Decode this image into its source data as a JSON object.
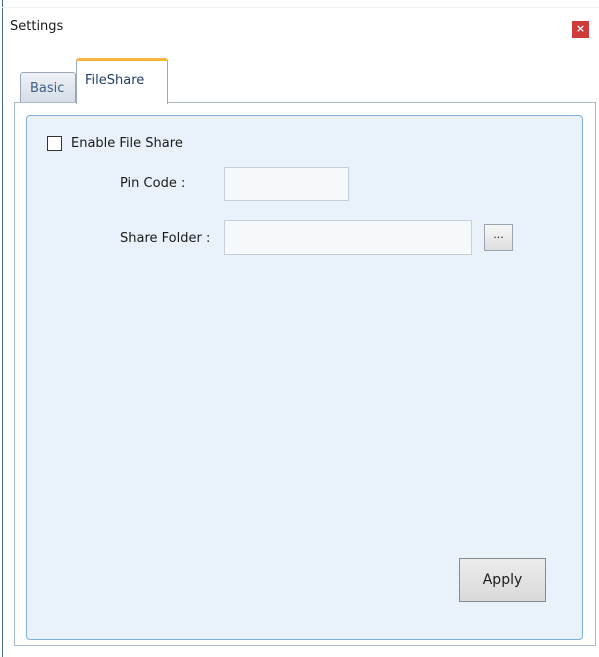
{
  "window": {
    "title": "Settings",
    "close_glyph": "×"
  },
  "tabs": [
    {
      "label": "Basic",
      "active": false
    },
    {
      "label": "FileShare",
      "active": true
    }
  ],
  "fileshare": {
    "enable_label": "Enable File Share",
    "enable_checked": false,
    "pin_label": "Pin Code :",
    "pin_value": "",
    "folder_label": "Share Folder :",
    "folder_value": "",
    "browse_label": "...",
    "apply_label": "Apply"
  },
  "colors": {
    "accent_tab": "#f4b63f",
    "close_button": "#cf3b3b",
    "panel_background": "#e9f1fa",
    "panel_border": "#7fb1db"
  },
  "icons": {
    "close": "close-icon"
  }
}
